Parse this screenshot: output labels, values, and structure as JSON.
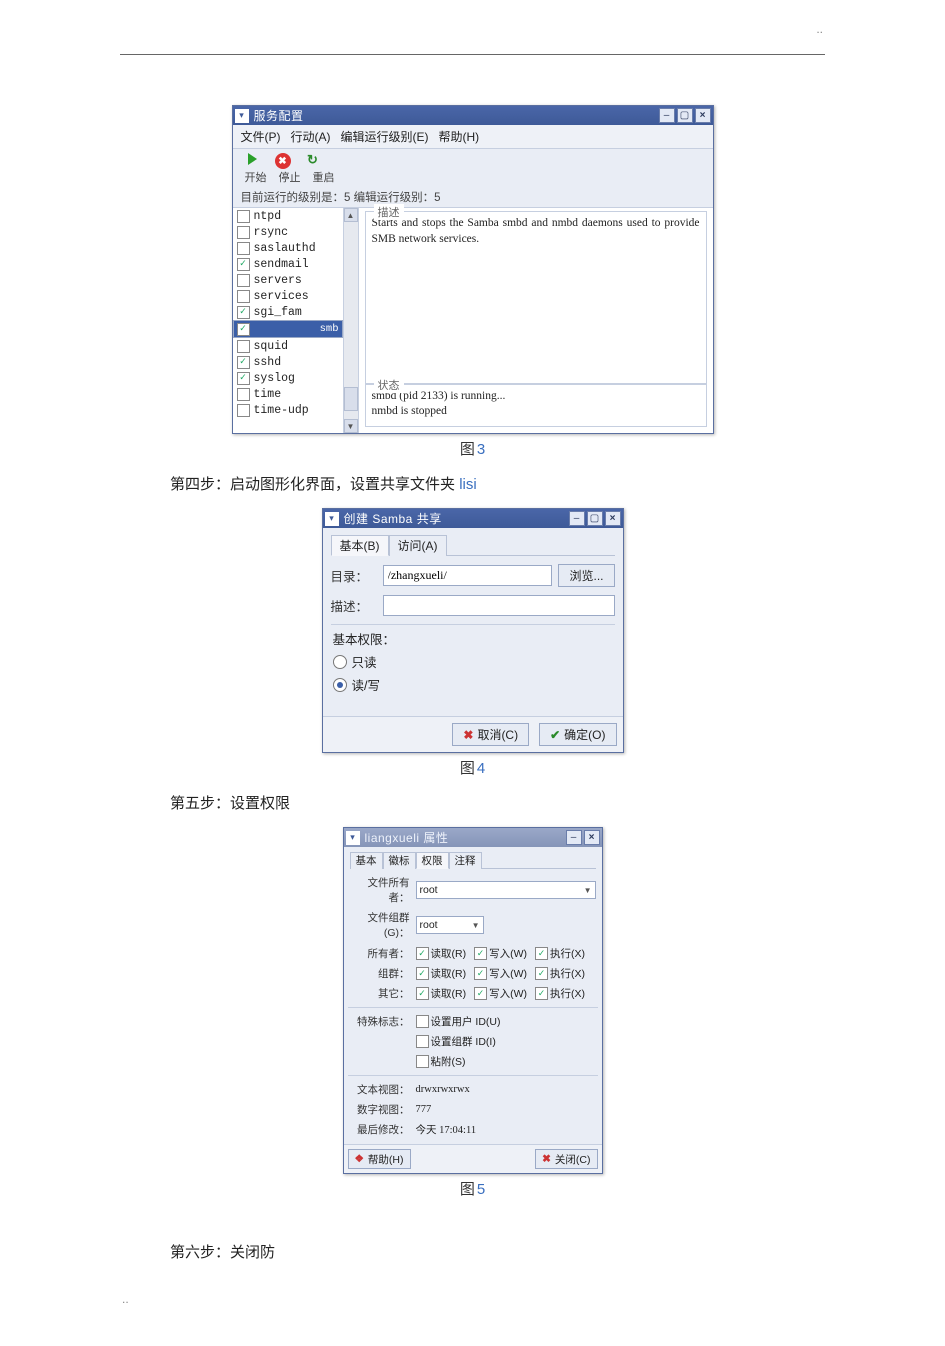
{
  "dots": "..",
  "fig3": {
    "title": "服务配置",
    "menu": {
      "file": "文件(P)",
      "action": "行动(A)",
      "runlevel": "编辑运行级别(E)",
      "help": "帮助(H)"
    },
    "tb": {
      "start": "开始",
      "stop": "停止",
      "reload": "重启"
    },
    "statusline": "目前运行的级别是：5  编辑运行级别：5",
    "services": [
      {
        "label": "ntpd",
        "checked": false
      },
      {
        "label": "rsync",
        "checked": false
      },
      {
        "label": "saslauthd",
        "checked": false
      },
      {
        "label": "sendmail",
        "checked": true
      },
      {
        "label": "servers",
        "checked": false
      },
      {
        "label": "services",
        "checked": false
      },
      {
        "label": "sgi_fam",
        "checked": true
      },
      {
        "label": "smb",
        "checked": true,
        "selected": true
      },
      {
        "label": "squid",
        "checked": false
      },
      {
        "label": "sshd",
        "checked": true
      },
      {
        "label": "syslog",
        "checked": true
      },
      {
        "label": "time",
        "checked": false
      },
      {
        "label": "time-udp",
        "checked": false
      }
    ],
    "desc_label": "描述",
    "desc": "Starts and stops the Samba smbd and nmbd daemons used to provide SMB network services.",
    "stat_label": "状态",
    "stat1": "smbd (pid 2133) is running...",
    "stat2": "nmbd is stopped"
  },
  "caption3_pre": "图",
  "caption3_num": "3",
  "step4": "第四步：启动图形化界面，设置共享文件夹",
  "step4_link": "lisi",
  "fig4": {
    "title": "创建 Samba 共享",
    "tab_basic": "基本(B)",
    "tab_access": "访问(A)",
    "dir_label": "目录：",
    "dir_value": "/zhangxueli/",
    "browse": "浏览...",
    "desc_label": "描述：",
    "perm_label": "基本权限：",
    "perm_ro": "只读",
    "perm_rw": "读/写",
    "cancel": "取消(C)",
    "ok": "确定(O)"
  },
  "caption4_pre": "图",
  "caption4_num": "4",
  "step5": "第五步：设置权限",
  "fig5": {
    "title": "liangxueli 属性",
    "tab_basic": "基本",
    "tab_icon": "徽标",
    "tab_perm": "权限",
    "tab_note": "注释",
    "owner_label": "文件所有者：",
    "owner_value": "root",
    "group_label": "文件组群(G)：",
    "group_value": "root",
    "row_owner": "所有者：",
    "row_group": "组群：",
    "row_other": "其它：",
    "read": "读取(R)",
    "write": "写入(W)",
    "exec": "执行(X)",
    "special_label": "特殊标志：",
    "setuid": "设置用户 ID(U)",
    "setgid": "设置组群 ID(I)",
    "sticky": "粘附(S)",
    "text_label": "文本视图：",
    "text_value": "drwxrwxrwx",
    "num_label": "数字视图：",
    "num_value": "777",
    "mtime_label": "最后修改：",
    "mtime_value": "今天 17:04:11",
    "help": "帮助(H)",
    "close": "关闭(C)"
  },
  "caption5_pre": "图",
  "caption5_num": "5",
  "step6": "第六步：关闭防"
}
